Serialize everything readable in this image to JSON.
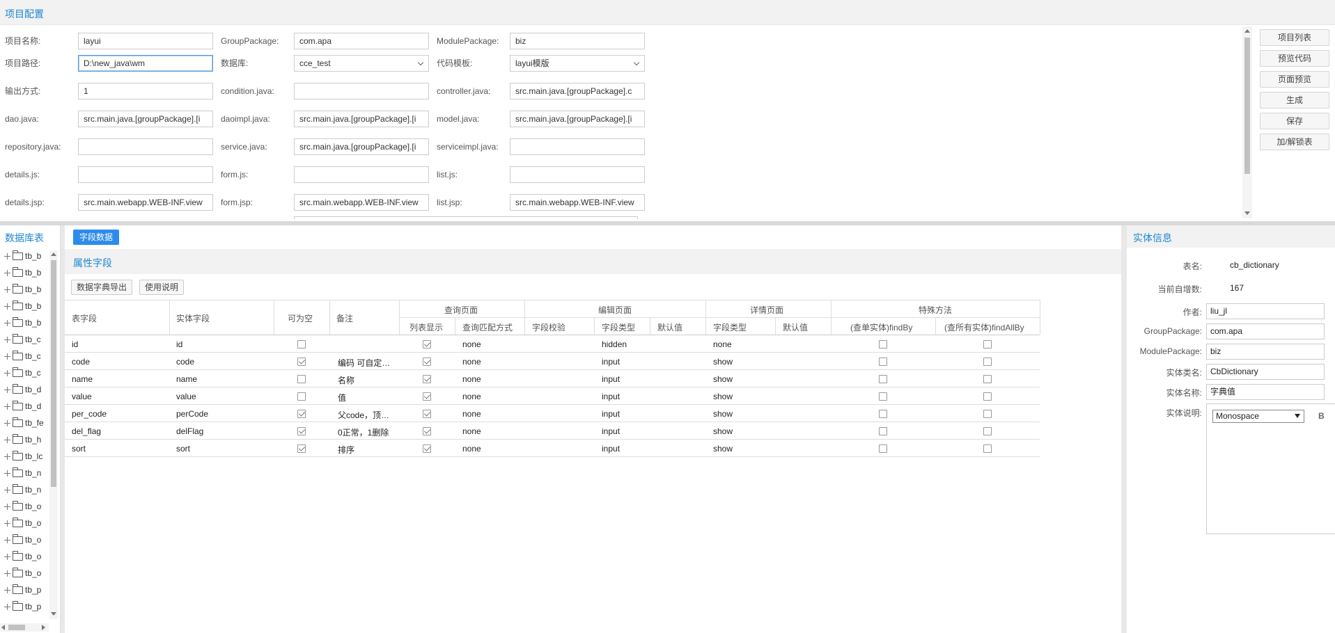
{
  "project": {
    "title": "项目配置",
    "fields": {
      "project_name": {
        "label": "项目名称:",
        "value": "layui"
      },
      "group_package": {
        "label": "GroupPackage:",
        "value": "com.apa"
      },
      "module_package": {
        "label": "ModulePackage:",
        "value": "biz"
      },
      "project_path": {
        "label": "项目路径:",
        "value": "D:\\new_java\\wm"
      },
      "database": {
        "label": "数据库:",
        "value": "cce_test"
      },
      "template": {
        "label": "代码模板:",
        "value": "layui模版"
      },
      "output_mode": {
        "label": "输出方式:",
        "value": "1"
      },
      "condition_java": {
        "label": "condition.java:",
        "value": ""
      },
      "controller_java": {
        "label": "controller.java:",
        "value": "src.main.java.[groupPackage].c"
      },
      "dao_java": {
        "label": "dao.java:",
        "value": "src.main.java.[groupPackage].[i"
      },
      "daoimpl_java": {
        "label": "daoimpl.java:",
        "value": "src.main.java.[groupPackage].[i"
      },
      "model_java": {
        "label": "model.java:",
        "value": "src.main.java.[groupPackage].[i"
      },
      "repository_java": {
        "label": "repository.java:",
        "value": ""
      },
      "service_java": {
        "label": "service.java:",
        "value": "src.main.java.[groupPackage].[i"
      },
      "serviceimpl_java": {
        "label": "serviceimpl.java:",
        "value": ""
      },
      "details_js": {
        "label": "details.js:",
        "value": ""
      },
      "form_js": {
        "label": "form.js:",
        "value": ""
      },
      "list_js": {
        "label": "list.js:",
        "value": ""
      },
      "details_jsp": {
        "label": "details.jsp:",
        "value": "src.main.webapp.WEB-INF.view"
      },
      "form_jsp": {
        "label": "form.jsp:",
        "value": "src.main.webapp.WEB-INF.view"
      },
      "list_jsp": {
        "label": "list.jsp:",
        "value": "src.main.webapp.WEB-INF.view"
      }
    },
    "buttons": [
      "项目列表",
      "预览代码",
      "页面预览",
      "生成",
      "保存",
      "加/解锁表"
    ]
  },
  "db_tree": {
    "title": "数据库表",
    "items": [
      "tb_b",
      "tb_b",
      "tb_b",
      "tb_b",
      "tb_b",
      "tb_c",
      "tb_c",
      "tb_c",
      "tb_d",
      "tb_d",
      "tb_fe",
      "tb_h",
      "tb_lc",
      "tb_n",
      "tb_n",
      "tb_o",
      "tb_o",
      "tb_o",
      "tb_o",
      "tb_o",
      "tb_p",
      "tb_p"
    ]
  },
  "fields_panel": {
    "tab": "字段数据",
    "title": "属性字段",
    "export_btn": "数据字典导出",
    "help_btn": "使用说明",
    "headers": {
      "table_field": "表字段",
      "entity_field": "实体字段",
      "nullable": "可为空",
      "remark": "备注",
      "query_page": "查询页面",
      "list_show": "列表显示",
      "match_mode": "查询匹配方式",
      "edit_page": "编辑页面",
      "validate": "字段校验",
      "field_type": "字段类型",
      "default": "默认值",
      "detail_page": "详情页面",
      "detail_type": "字段类型",
      "detail_default": "默认值",
      "special": "特殊方法",
      "find_by": "(查单实体)findBy",
      "find_all_by": "(查所有实体)findAllBy"
    },
    "rows": [
      {
        "col": "id",
        "prop": "id",
        "nullable": false,
        "remark": "",
        "list": true,
        "match": "none",
        "etype": "hidden",
        "dtype": "none",
        "findBy": false,
        "findAllBy": false
      },
      {
        "col": "code",
        "prop": "code",
        "nullable": true,
        "remark": "编码 可自定…",
        "list": true,
        "match": "none",
        "etype": "input",
        "dtype": "show",
        "findBy": false,
        "findAllBy": false
      },
      {
        "col": "name",
        "prop": "name",
        "nullable": false,
        "remark": "名称",
        "list": true,
        "match": "none",
        "etype": "input",
        "dtype": "show",
        "findBy": false,
        "findAllBy": false
      },
      {
        "col": "value",
        "prop": "value",
        "nullable": false,
        "remark": "值",
        "list": true,
        "match": "none",
        "etype": "input",
        "dtype": "show",
        "findBy": false,
        "findAllBy": false
      },
      {
        "col": "per_code",
        "prop": "perCode",
        "nullable": true,
        "remark": "父code，顶…",
        "list": true,
        "match": "none",
        "etype": "input",
        "dtype": "show",
        "findBy": false,
        "findAllBy": false
      },
      {
        "col": "del_flag",
        "prop": "delFlag",
        "nullable": true,
        "remark": "0正常，1删除",
        "list": true,
        "match": "none",
        "etype": "input",
        "dtype": "show",
        "findBy": false,
        "findAllBy": false
      },
      {
        "col": "sort",
        "prop": "sort",
        "nullable": true,
        "remark": "排序",
        "list": true,
        "match": "none",
        "etype": "input",
        "dtype": "show",
        "findBy": false,
        "findAllBy": false
      }
    ]
  },
  "entity": {
    "title": "实体信息",
    "table_name_label": "表名:",
    "table_name": "cb_dictionary",
    "auto_inc_label": "当前自增数:",
    "auto_inc": "167",
    "author_label": "作者:",
    "author": "liu_jl",
    "group_label": "GroupPackage:",
    "group": "com.apa",
    "module_label": "ModulePackage:",
    "module": "biz",
    "class_label": "实体类名:",
    "class_name": "CbDictionary",
    "entity_name_label": "实体名称:",
    "entity_name": "字典值",
    "desc_label": "实体说明:",
    "font": "Monospace",
    "bold": "B"
  }
}
